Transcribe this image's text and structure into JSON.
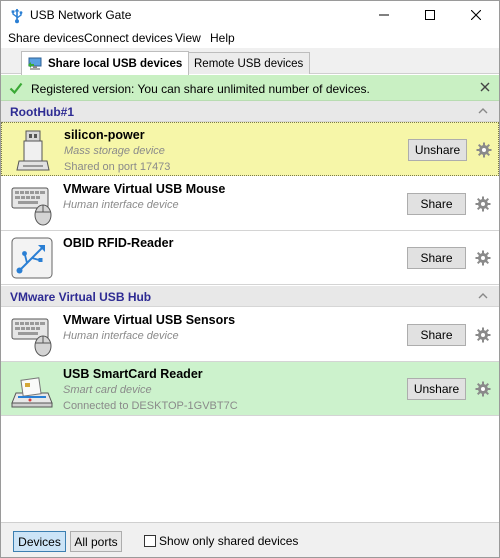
{
  "window": {
    "title": "USB Network Gate"
  },
  "menu": {
    "items": [
      {
        "label": "Share devices"
      },
      {
        "label": "Connect devices"
      },
      {
        "label": "View"
      },
      {
        "label": "Help"
      }
    ]
  },
  "tabs": [
    {
      "label": "Share local USB devices",
      "active": true
    },
    {
      "label": "Remote USB devices",
      "active": false
    }
  ],
  "notice": {
    "text": "Registered version: You can share unlimited number of devices."
  },
  "hubs": [
    {
      "label": "RootHub#1",
      "devices": [
        {
          "name": "silicon-power",
          "type": "Mass storage device",
          "status": "Shared on port 17473",
          "button": "Unshare",
          "icon": "usb-drive-icon"
        },
        {
          "name": "VMware Virtual USB Mouse",
          "type": "Human interface device",
          "status": "",
          "button": "Share",
          "icon": "keyboard-mouse-icon"
        },
        {
          "name": "OBID RFID-Reader",
          "type": "",
          "status": "",
          "button": "Share",
          "icon": "usb-symbol-icon"
        }
      ]
    },
    {
      "label": "VMware Virtual USB Hub",
      "devices": [
        {
          "name": "VMware Virtual USB Sensors",
          "type": "Human interface device",
          "status": "",
          "button": "Share",
          "icon": "keyboard-mouse-icon"
        },
        {
          "name": "USB SmartCard Reader",
          "type": "Smart card device",
          "status": "Connected to DESKTOP-1GVBT7C",
          "button": "Unshare",
          "icon": "smartcard-reader-icon"
        }
      ]
    }
  ],
  "footer": {
    "devices_label": "Devices",
    "ports_label": "All ports",
    "show_shared_label": "Show only shared devices",
    "show_shared_checked": false
  },
  "colors": {
    "hub_label": "#2e2b93",
    "notice_bg": "#c9f0c3",
    "shared_local_bg": "#f6f6a8",
    "shared_remote_bg": "#ccf2cc",
    "check_green": "#3aa935"
  }
}
